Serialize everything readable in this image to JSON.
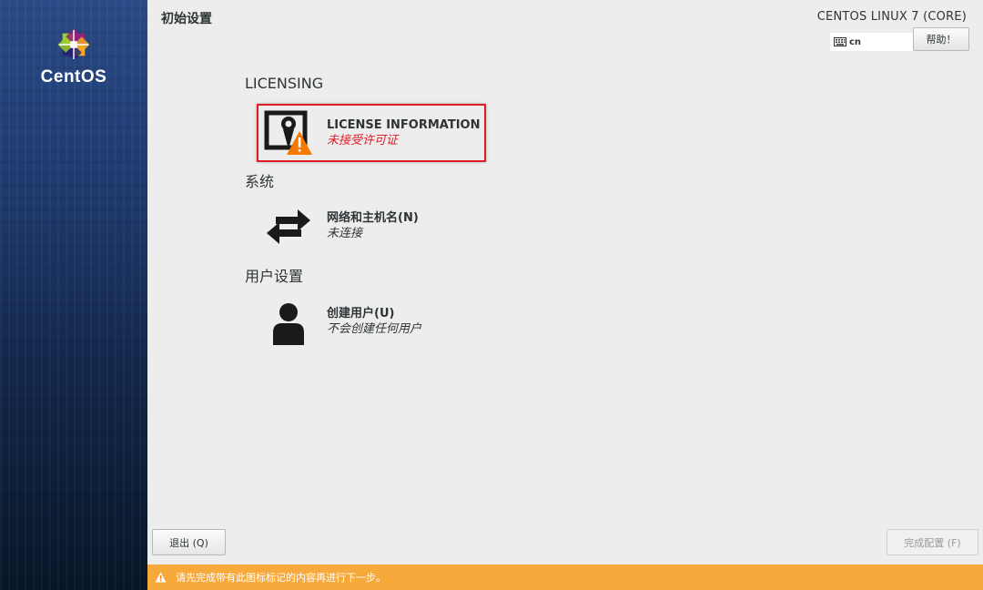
{
  "sidebar": {
    "logo_text": "CentOS"
  },
  "header": {
    "page_title": "初始设置",
    "product_title": "CENTOS LINUX 7 (CORE)",
    "keyboard_layout": "cn",
    "help_label": "帮助！"
  },
  "sections": {
    "licensing": {
      "heading": "LICENSING",
      "spoke": {
        "title": "LICENSE INFORMATION",
        "status": "未接受许可证",
        "icon": "license-warning-icon"
      }
    },
    "system": {
      "heading": "系统",
      "spoke": {
        "title": "网络和主机名(N)",
        "status": "未连接",
        "icon": "network-arrows-icon"
      }
    },
    "user": {
      "heading": "用户设置",
      "spoke": {
        "title": "创建用户(U)",
        "status": "不会创建任何用户",
        "icon": "user-icon"
      }
    }
  },
  "footer": {
    "quit_label": "退出 (Q)",
    "finish_label": "完成配置 (F)",
    "warning_text": "请先完成带有此图标标记的内容再进行下一步。"
  },
  "colors": {
    "warning_bar": "#f7a93b",
    "warning_text_red": "#e01b24",
    "background": "#ededed"
  }
}
